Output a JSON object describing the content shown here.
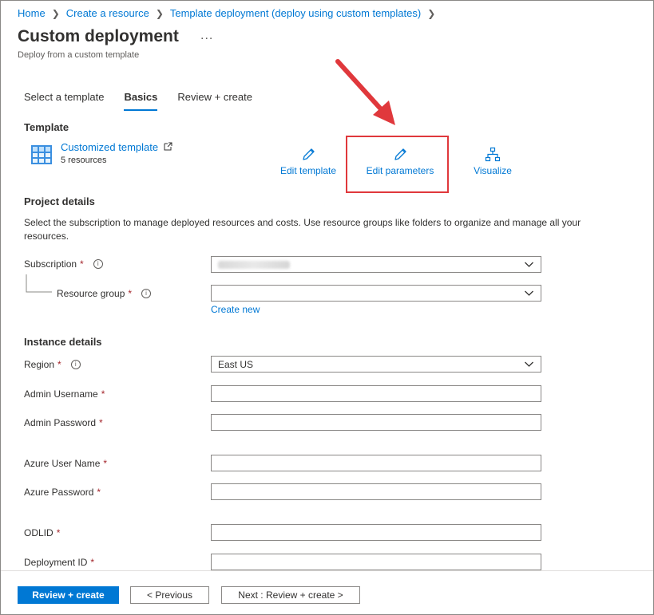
{
  "breadcrumb": [
    "Home",
    "Create a resource",
    "Template deployment (deploy using custom templates)"
  ],
  "page": {
    "title": "Custom deployment",
    "more": "...",
    "subtitle": "Deploy from a custom template"
  },
  "tabs": [
    {
      "label": "Select a template",
      "active": false
    },
    {
      "label": "Basics",
      "active": true
    },
    {
      "label": "Review + create",
      "active": false
    }
  ],
  "template": {
    "heading": "Template",
    "name": "Customized template",
    "resources": "5 resources",
    "actions": {
      "edit_template": "Edit template",
      "edit_parameters": "Edit parameters",
      "visualize": "Visualize"
    }
  },
  "project": {
    "heading": "Project details",
    "description": "Select the subscription to manage deployed resources and costs. Use resource groups like folders to organize and manage all your resources.",
    "subscription_label": "Subscription",
    "resource_group_label": "Resource group",
    "resource_group_value": "",
    "create_new": "Create new"
  },
  "instance": {
    "heading": "Instance details",
    "region_label": "Region",
    "region_value": "East US",
    "admin_username_label": "Admin Username",
    "admin_password_label": "Admin Password",
    "azure_user_label": "Azure User Name",
    "azure_password_label": "Azure Password",
    "odlid_label": "ODLID",
    "deployment_id_label": "Deployment ID"
  },
  "required_marker": "*",
  "info_glyph": "i",
  "footer": {
    "review_create": "Review + create",
    "previous": "< Previous",
    "next": "Next : Review + create >"
  },
  "colors": {
    "accent": "#0078d4",
    "annotation_red": "#e0383c",
    "required": "#a4262c"
  }
}
